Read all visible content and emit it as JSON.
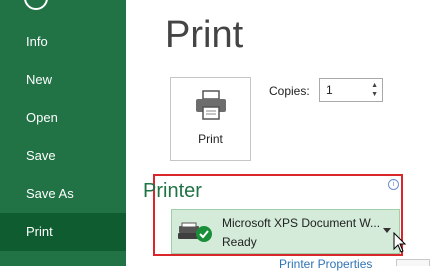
{
  "sidebar": {
    "items": [
      {
        "label": "Info"
      },
      {
        "label": "New"
      },
      {
        "label": "Open"
      },
      {
        "label": "Save"
      },
      {
        "label": "Save As"
      },
      {
        "label": "Print",
        "selected": true
      }
    ]
  },
  "main": {
    "title": "Print",
    "print_button_label": "Print",
    "copies_label": "Copies:",
    "copies_value": "1",
    "printer_heading": "Printer",
    "info_icon": "i",
    "selected_printer": {
      "name": "Microsoft XPS Document W...",
      "status": "Ready"
    },
    "printer_properties_link": "Printer Properties"
  },
  "colors": {
    "sidebar_bg": "#217346",
    "sidebar_selected": "#0e5c2f",
    "accent_green": "#217346",
    "highlight_red": "#d9262b",
    "dropdown_bg": "#d3ebd8",
    "link_blue": "#2e75b6"
  },
  "icons": [
    "back-arrow-icon",
    "printer-icon",
    "info-icon",
    "printer-status-icon",
    "dropdown-arrow-icon",
    "mouse-cursor-icon"
  ]
}
